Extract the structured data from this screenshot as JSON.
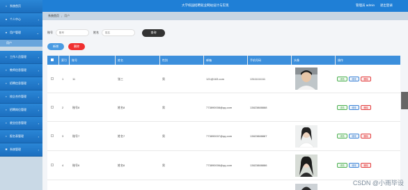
{
  "header": {
    "title": "大学校园招聘就业网站设计与实现",
    "user": "管理员 admin",
    "logout": "退出登录"
  },
  "breadcrumb": {
    "home": "系统首页",
    "separator": "/",
    "current": "用户"
  },
  "sidebar": {
    "items": [
      {
        "label": "系统首页",
        "icon": "home-icon"
      },
      {
        "label": "个人中心",
        "icon": "user-icon"
      },
      {
        "label": "用户管理",
        "icon": "users-icon"
      },
      {
        "label": "工作人员管理",
        "icon": "staff-icon"
      },
      {
        "label": "教师信息管理",
        "icon": "grid-icon"
      },
      {
        "label": "招聘信息管理",
        "icon": "grid-icon"
      },
      {
        "label": "校企合作管理",
        "icon": "grid-icon"
      },
      {
        "label": "招聘岗位管理",
        "icon": "grid-icon"
      },
      {
        "label": "就业信息管理",
        "icon": "grid-icon"
      },
      {
        "label": "报名表管理",
        "icon": "grid-icon"
      },
      {
        "label": "系统管理",
        "icon": "settings-icon"
      }
    ],
    "sub_item": "用户"
  },
  "search": {
    "account_label": "账号",
    "account_placeholder": "账号",
    "name_label": "姓名",
    "name_placeholder": "姓名",
    "button": "查询"
  },
  "actions": {
    "add": "新增",
    "delete": "删除"
  },
  "table": {
    "headers": [
      "索引",
      "账号",
      "姓名",
      "性别",
      "邮箱",
      "手机号码",
      "头像",
      "操作"
    ],
    "rows": [
      {
        "index": "1",
        "account": "11",
        "name": "张三",
        "gender": "男",
        "email": "121@163.com",
        "phone": "13111111111",
        "has_avatar": true,
        "avatar_style": "male"
      },
      {
        "index": "2",
        "account": "账号8",
        "name": "姓名8",
        "gender": "男",
        "email": "773890008@qq.com",
        "phone": "13823888888",
        "has_avatar": false,
        "avatar_style": ""
      },
      {
        "index": "3",
        "account": "账号7",
        "name": "姓名7",
        "gender": "男",
        "email": "773890007@qq.com",
        "phone": "13823888887",
        "has_avatar": true,
        "avatar_style": "female-white"
      },
      {
        "index": "4",
        "account": "账号6",
        "name": "姓名6",
        "gender": "男",
        "email": "773890006@qq.com",
        "phone": "13823888886",
        "has_avatar": true,
        "avatar_style": "female-dark"
      }
    ],
    "op_labels": {
      "detail": "详情",
      "edit": "修改",
      "remove": "删除"
    }
  },
  "watermark": "CSDN @小雨毕设",
  "colors": {
    "header": "#1f7fd6",
    "table_header": "#3c8fdc",
    "danger": "#f03030",
    "primary": "#4a9be2"
  }
}
